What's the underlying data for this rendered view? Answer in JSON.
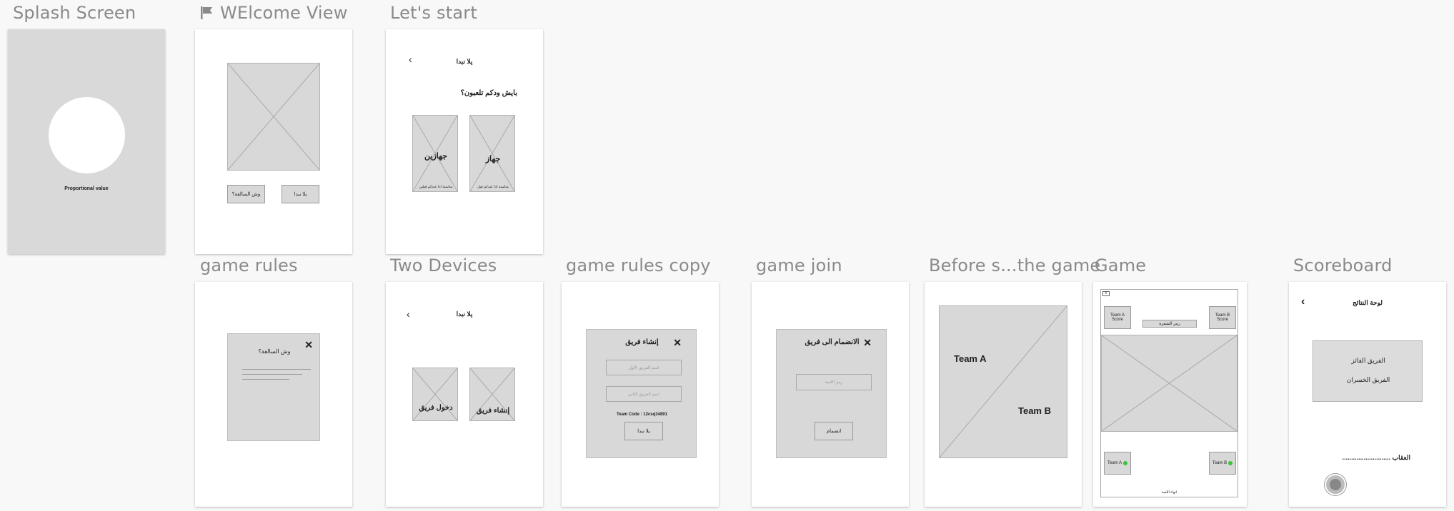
{
  "canvas": {
    "background": "#f8f8f8",
    "board_gray": "#d9d9d9",
    "wire_gray": "#d8d8d8"
  },
  "labels": {
    "splash": "Splash Screen",
    "welcome": "WElcome View",
    "lets_start": "Let's start",
    "game_rules": "game rules",
    "two_devices": "Two Devices",
    "game_rules_copy": "game rules copy",
    "game_join": "game join",
    "before_start": "Before s...the game",
    "game": "Game",
    "scoreboard": "Scoreboard"
  },
  "splash": {
    "caption": "Proportional value"
  },
  "welcome": {
    "btn_rules": "وش السالفة؟",
    "btn_start": "يلا نبدا"
  },
  "lets_start": {
    "title": "يلا نبدا",
    "question": "بايش ودكم تلعبون؟",
    "card_two": "جهازين",
    "card_two_sub": "مناسبة اذا عندكم فيلين",
    "card_one": "جهاز",
    "card_one_sub": "مناسبة اذا عندكم فيل"
  },
  "game_rules": {
    "title": "وش السالفة؟"
  },
  "two_devices": {
    "title": "يلا نبدا",
    "card_join": "دخول فريق",
    "card_create": "إنشاء فريق"
  },
  "rules_copy": {
    "title": "إنشاء فريق",
    "field1": "اسم الفريق الأول",
    "field2": "اسم الفريق الثاني",
    "team_code": "Team Code : 12csq34891",
    "btn": "يلا نبدا"
  },
  "join": {
    "title": "الانضمام الى فريق",
    "field": "رمز اللعبة",
    "btn": "انضمام"
  },
  "before": {
    "team_a": "Team A",
    "team_b": "Team B"
  },
  "game": {
    "team_a_score": "Team A\nScore",
    "team_b_score": "Team B\nScore",
    "code": "رمز الشفرة",
    "team_a": "Team A",
    "team_b": "Team B",
    "end": "انهاء اللعبة"
  },
  "scoreboard": {
    "title": "لوحة النتائج",
    "winner": "الفريق الفائز",
    "loser": "الفريق الخسران",
    "penalty": "العقاب ..........................."
  }
}
